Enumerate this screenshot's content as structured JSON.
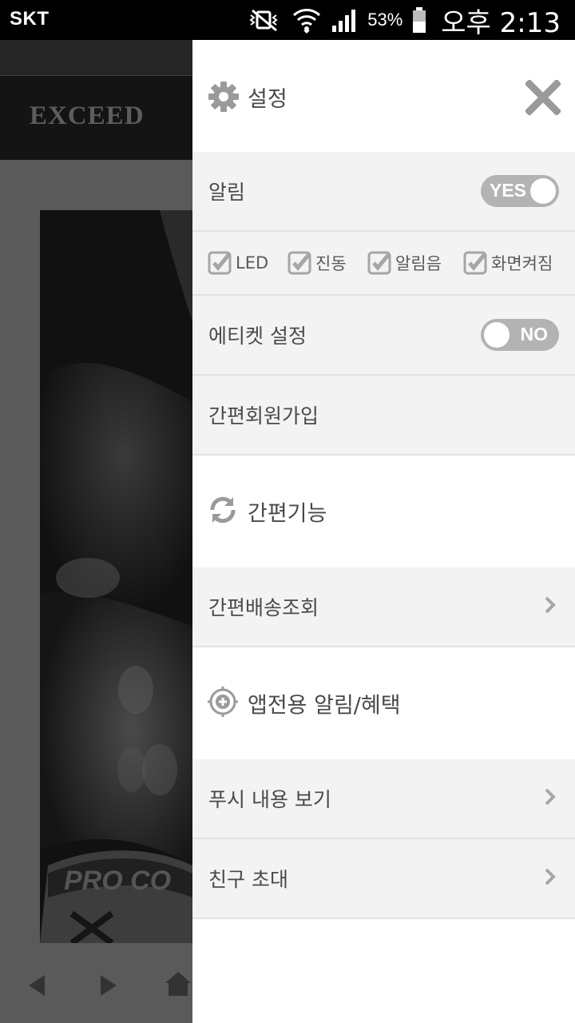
{
  "status_bar": {
    "carrier": "SKT",
    "battery_percent": "53%",
    "time": "오후 2:13",
    "icons": [
      "mute-vibrate-icon",
      "wifi-icon",
      "signal-icon",
      "battery-icon"
    ]
  },
  "background_app": {
    "logo": "EXCEED",
    "nav_icons": [
      "back-arrow-icon",
      "forward-arrow-icon",
      "home-icon"
    ]
  },
  "drawer": {
    "header": {
      "title": "설정",
      "icon": "gear-icon",
      "close_icon": "close-icon"
    },
    "notification": {
      "label": "알림",
      "toggle_label": "YES",
      "state": "on"
    },
    "options": [
      {
        "label": "LED",
        "checked": true
      },
      {
        "label": "진동",
        "checked": true
      },
      {
        "label": "알림음",
        "checked": true
      },
      {
        "label": "화면켜짐",
        "checked": true
      }
    ],
    "etiquette": {
      "label": "에티켓 설정",
      "toggle_label": "NO",
      "state": "off"
    },
    "simple_signup": {
      "label": "간편회원가입"
    },
    "section_features": {
      "title": "간편기능",
      "icon": "refresh-icon"
    },
    "delivery": {
      "label": "간편배송조회"
    },
    "section_benefits": {
      "title": "앱전용 알림/혜택",
      "icon": "target-plus-icon"
    },
    "push_view": {
      "label": "푸시 내용 보기"
    },
    "invite": {
      "label": "친구 초대"
    }
  },
  "colors": {
    "drawer_bg": "#ffffff",
    "row_gray": "#f3f3f3",
    "divider": "#e2e2e2",
    "text": "#4a4a4a",
    "icon_gray": "#9a9a9a",
    "toggle_bg": "#b3b3b3"
  }
}
